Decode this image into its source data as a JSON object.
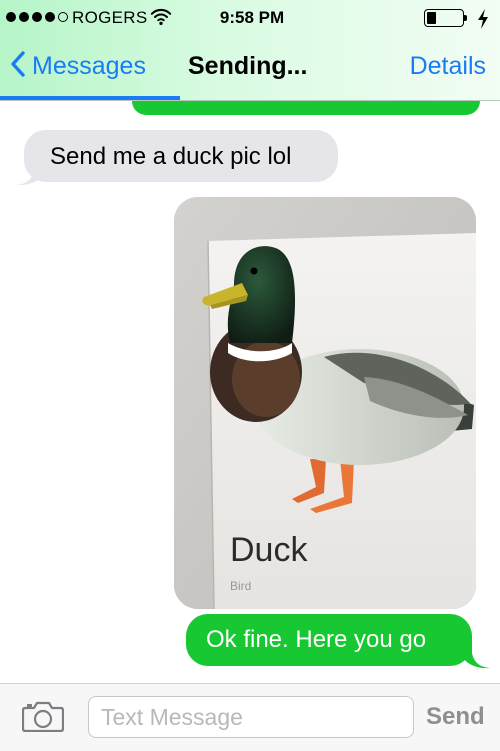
{
  "status_bar": {
    "carrier": "ROGERS",
    "time": "9:58 PM",
    "signal_bars_filled": 4,
    "signal_bars_total": 5,
    "battery_level": 0.25,
    "charging": true
  },
  "nav": {
    "back_label": "Messages",
    "title": "Sending...",
    "details_label": "Details",
    "send_progress": 0.36
  },
  "conversation": {
    "incoming_message": "Send me a duck pic lol",
    "photo": {
      "caption": "Duck",
      "subcaption": "Bird"
    },
    "outgoing_message": "Ok fine. Here you go"
  },
  "composer": {
    "placeholder": "Text Message",
    "value": "",
    "send_label": "Send"
  },
  "colors": {
    "accent_blue": "#1a7cf5",
    "imessage_green": "#17c832",
    "incoming_gray": "#e6e5ea"
  },
  "icons": [
    "wifi-icon",
    "battery-icon",
    "charging-bolt-icon",
    "back-chevron-icon",
    "camera-icon"
  ]
}
